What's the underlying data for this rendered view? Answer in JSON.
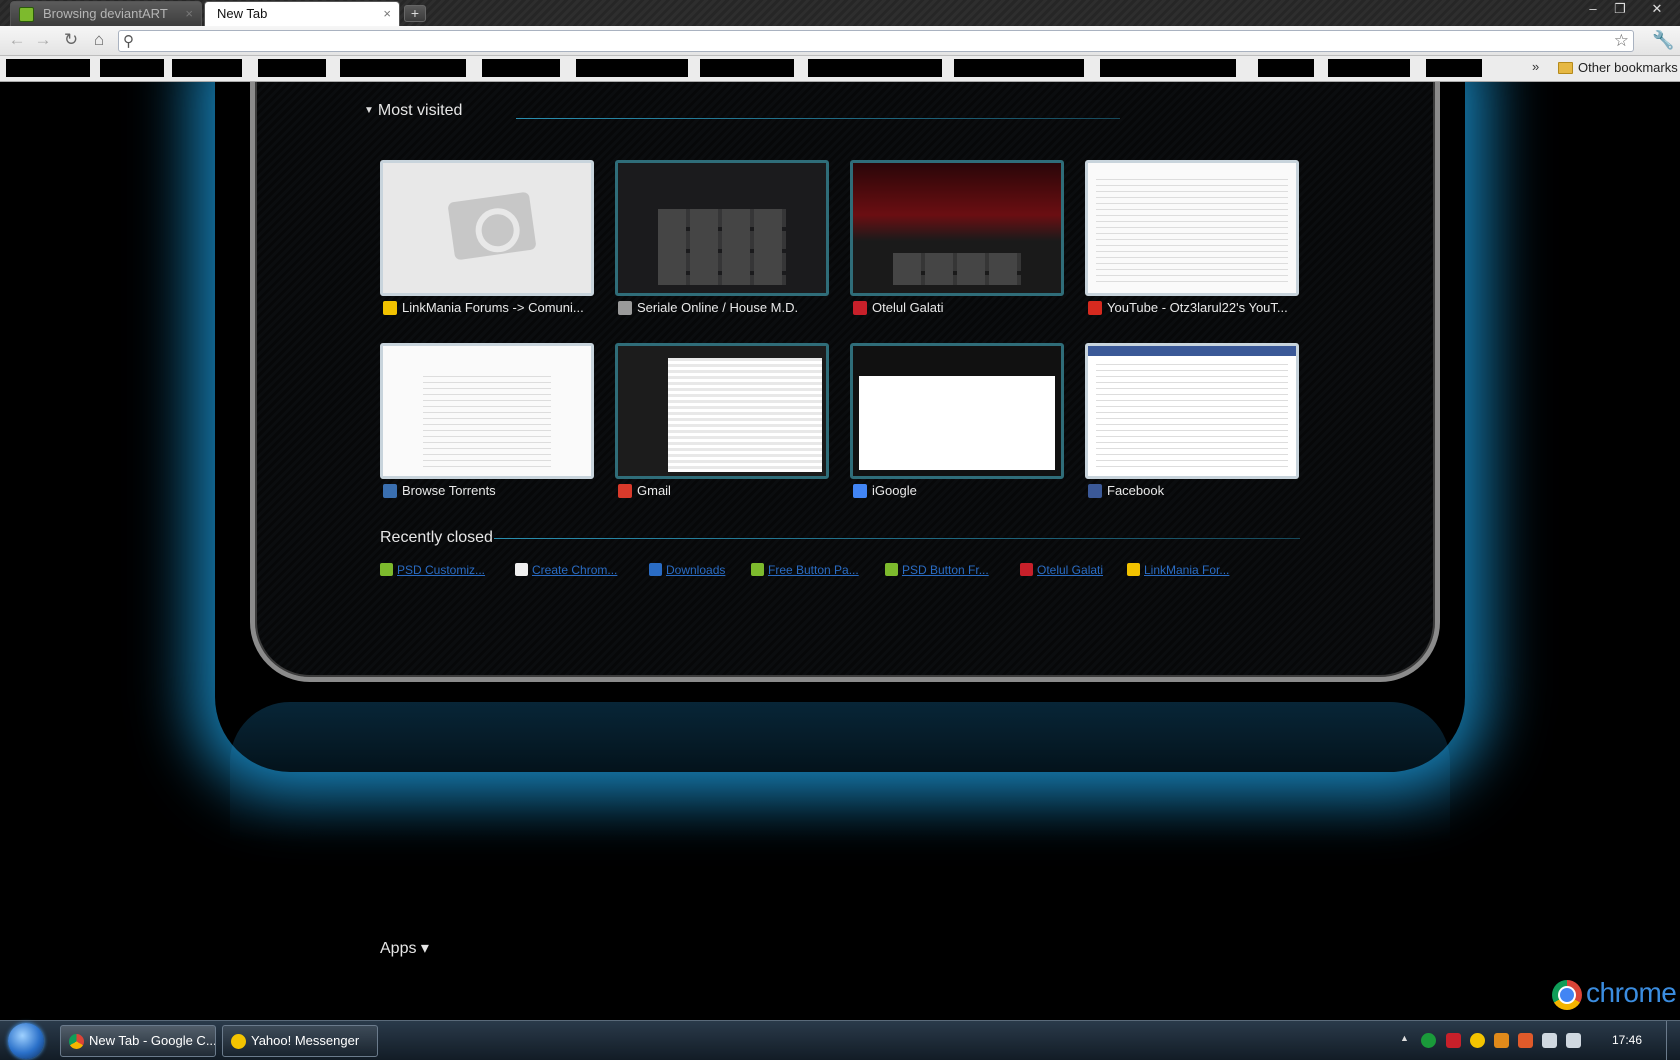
{
  "browser": {
    "tabs": [
      {
        "label": "Browsing deviantART",
        "active": false
      },
      {
        "label": "New Tab",
        "active": true
      }
    ],
    "new_tab_symbol": "+",
    "tab_close_symbol": "×",
    "window_controls": {
      "minimize": "–",
      "maximize": "❐",
      "close": "✕"
    },
    "nav": {
      "back": "←",
      "forward": "→",
      "reload": "↻",
      "home": "⌂"
    },
    "omnibox": {
      "value": "",
      "search_symbol": "⚲",
      "star_symbol": "☆"
    },
    "wrench_symbol": "🔧",
    "bookmarks_overflow": "»",
    "other_bookmarks": "Other bookmarks"
  },
  "ntp": {
    "most_visited": {
      "heading": "Most visited",
      "tiles": [
        {
          "title": "LinkMania Forums -> Comuni...",
          "fav_color": "#f2c200"
        },
        {
          "title": "Seriale Online / House M.D.",
          "fav_color": "#9a9a9a"
        },
        {
          "title": "Otelul Galati",
          "fav_color": "#c8202a"
        },
        {
          "title": "YouTube - Otz3larul22's YouT...",
          "fav_color": "#d62a1f"
        },
        {
          "title": "Browse Torrents",
          "fav_color": "#3a6fb0"
        },
        {
          "title": "Gmail",
          "fav_color": "#d93a2b"
        },
        {
          "title": "iGoogle",
          "fav_color": "#4285f4"
        },
        {
          "title": "Facebook",
          "fav_color": "#3b5998"
        }
      ]
    },
    "recently_closed": {
      "heading": "Recently closed",
      "items": [
        {
          "label": "PSD Customiz...",
          "fav_color": "#7dba2d"
        },
        {
          "label": "Create Chrom...",
          "fav_color": "#f0f0f0"
        },
        {
          "label": "Downloads",
          "fav_color": "#2a6cc4"
        },
        {
          "label": "Free Button Pa...",
          "fav_color": "#7dba2d"
        },
        {
          "label": "PSD Button Fr...",
          "fav_color": "#7dba2d"
        },
        {
          "label": "Otelul Galati",
          "fav_color": "#c8202a"
        },
        {
          "label": "LinkMania For...",
          "fav_color": "#f2c200"
        }
      ]
    },
    "apps": {
      "label": "Apps ▾"
    },
    "branding": "chrome"
  },
  "taskbar": {
    "buttons": [
      {
        "label": "New Tab - Google C...",
        "ico_color": "#e04b3a"
      },
      {
        "label": "Yahoo! Messenger",
        "ico_color": "#f4c400"
      }
    ],
    "tray_arrow": "▲",
    "clock": "17:46"
  },
  "colors": {
    "accent_glow": "#1ea0e6",
    "link": "#2a6cc4"
  }
}
